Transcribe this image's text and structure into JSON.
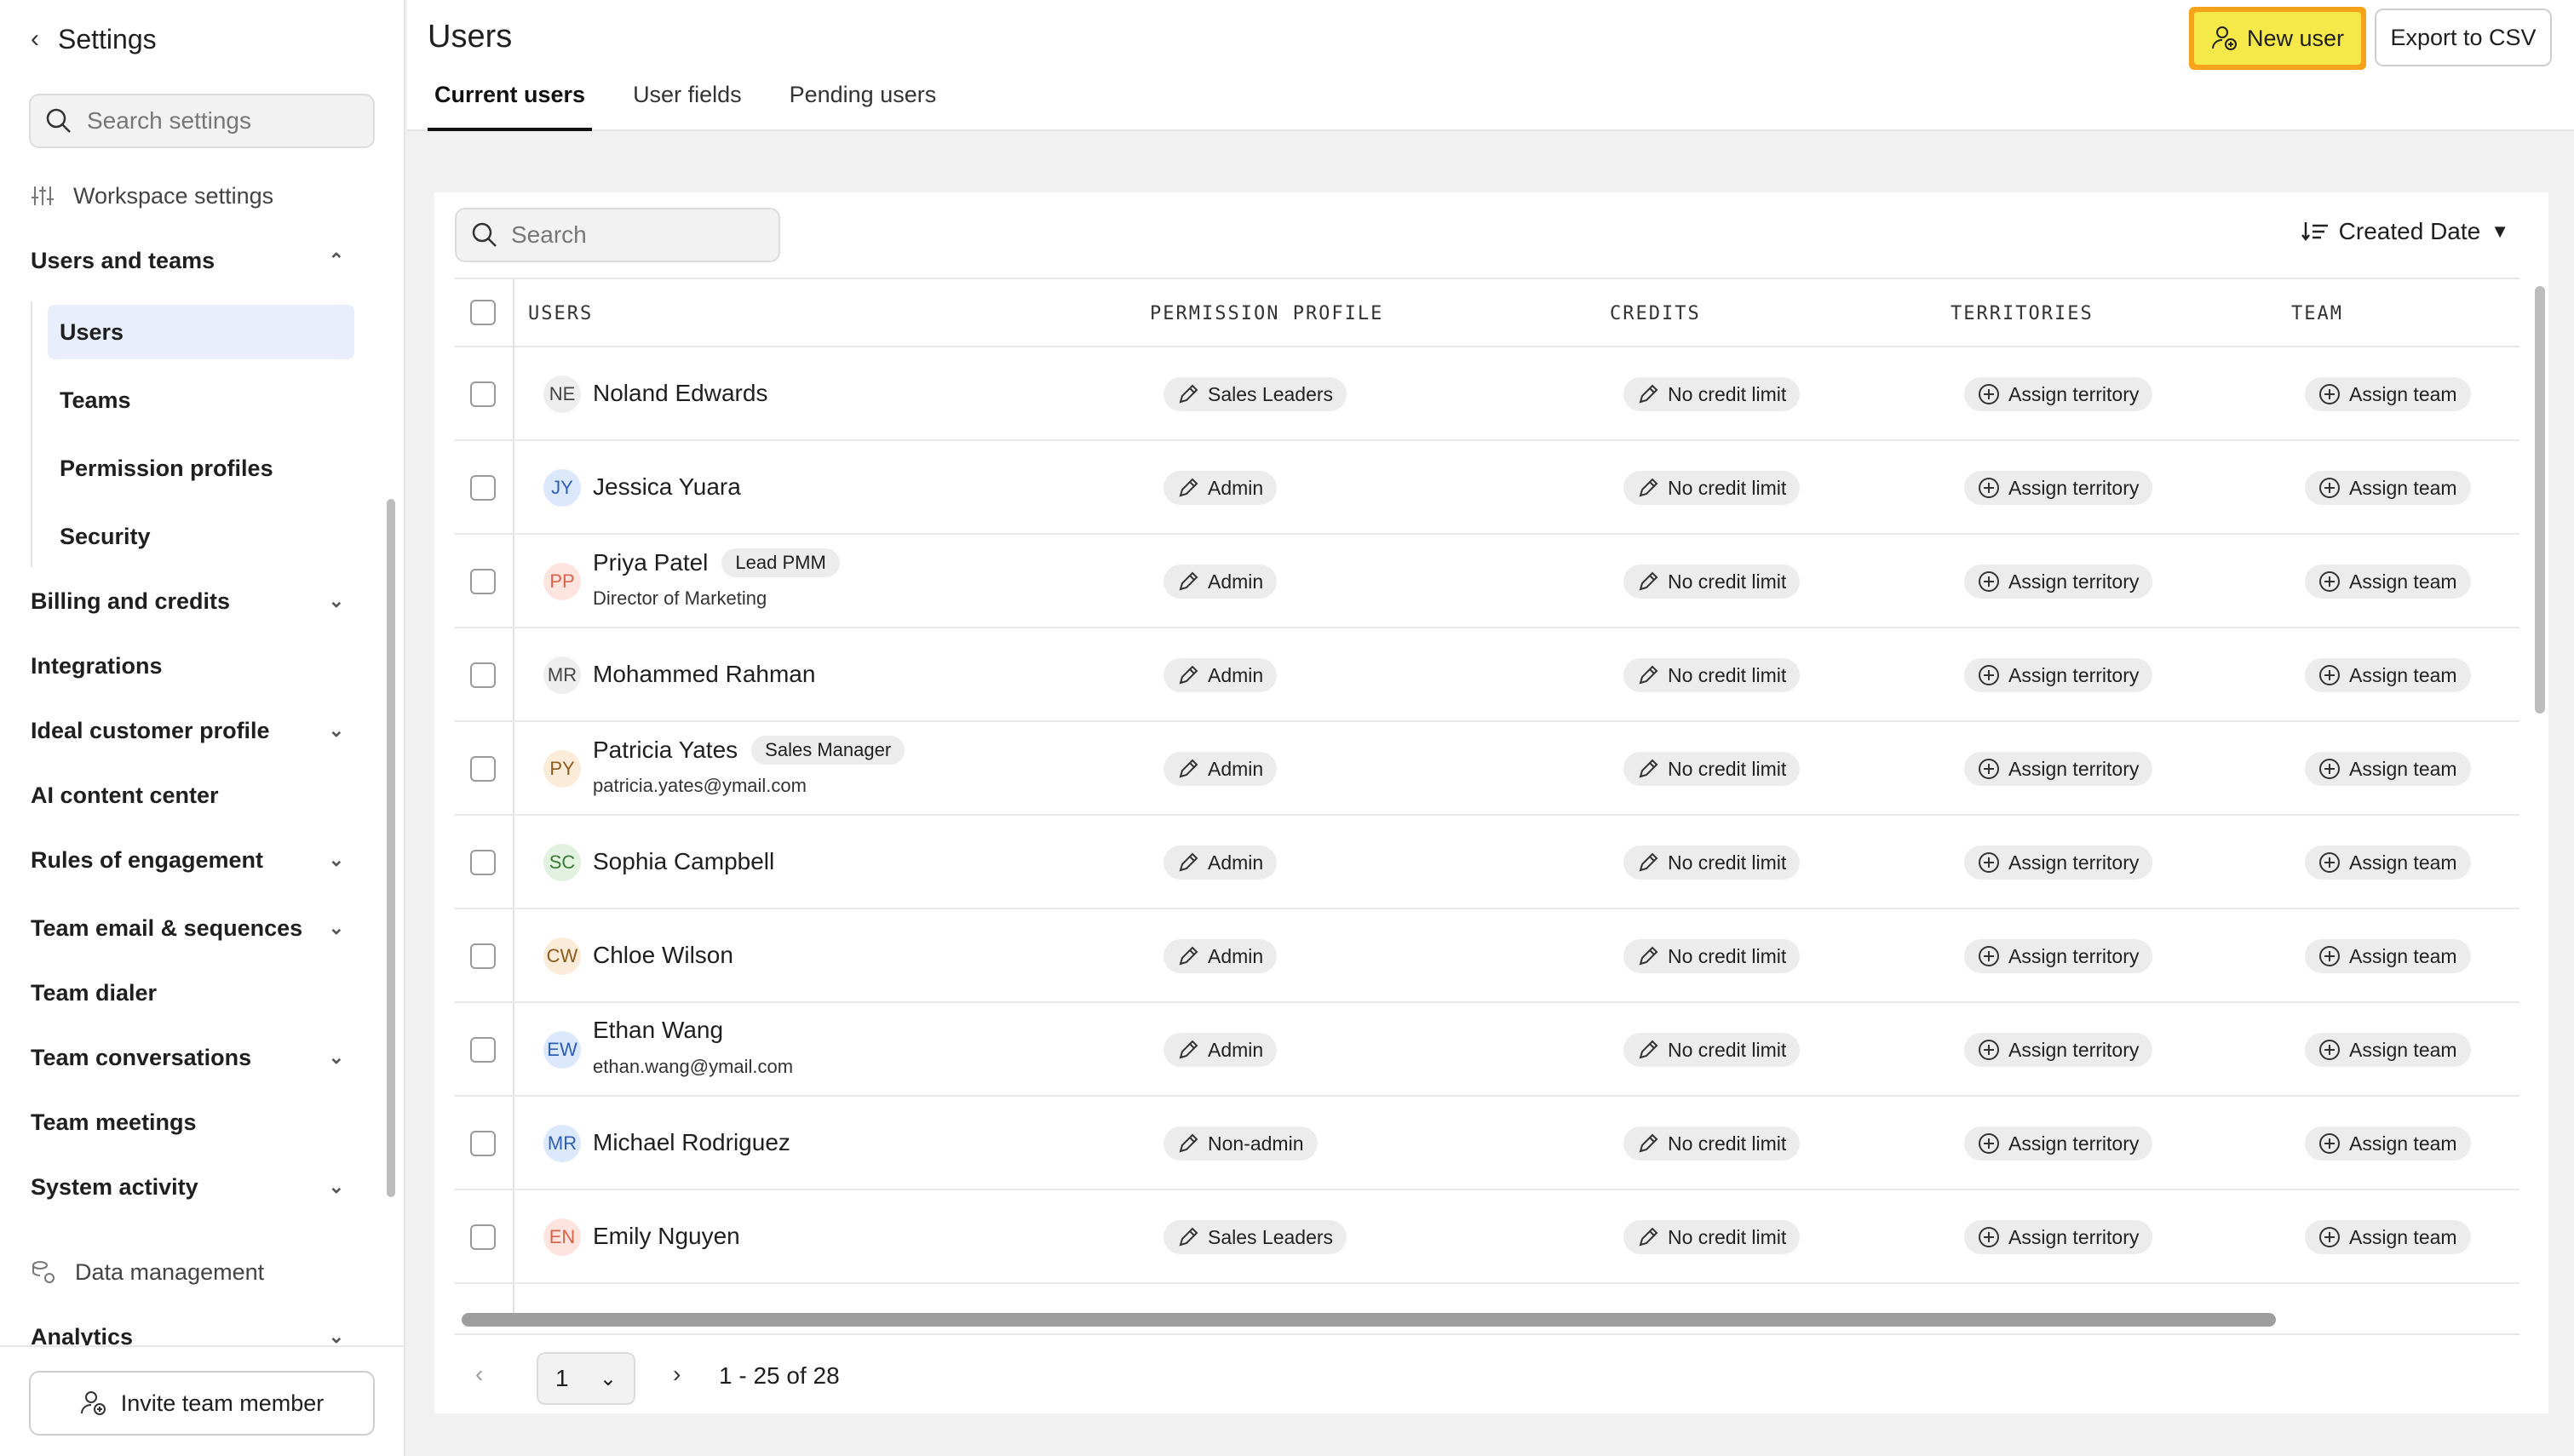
{
  "sidebar": {
    "title": "Settings",
    "search_placeholder": "Search settings",
    "workspace_settings": "Workspace settings",
    "users_and_teams": "Users and teams",
    "sub": [
      "Users",
      "Teams",
      "Permission profiles",
      "Security"
    ],
    "billing": "Billing and credits",
    "integrations": "Integrations",
    "icp": "Ideal customer profile",
    "ai_content": "AI content center",
    "rules": "Rules of engagement",
    "team_email": "Team email & sequences",
    "team_dialer": "Team dialer",
    "team_conversations": "Team conversations",
    "team_meetings": "Team meetings",
    "system_activity": "System activity",
    "data_management": "Data management",
    "analytics": "Analytics",
    "invite": "Invite team member"
  },
  "header": {
    "title": "Users",
    "tabs": [
      "Current users",
      "User fields",
      "Pending users"
    ],
    "new_user": "New user",
    "export": "Export to CSV"
  },
  "table": {
    "search_placeholder": "Search",
    "sort_label": "Created Date",
    "columns": [
      "USERS",
      "PERMISSION PROFILE",
      "CREDITS",
      "TERRITORIES",
      "TEAM"
    ],
    "assign_territory": "Assign territory",
    "assign_team": "Assign team",
    "rows": [
      {
        "initials": "NE",
        "name": "Noland Edwards",
        "tag": "",
        "sub": "",
        "profile": "Sales Leaders",
        "credits": "No credit limit"
      },
      {
        "initials": "JY",
        "name": "Jessica Yuara",
        "tag": "",
        "sub": "",
        "profile": "Admin",
        "credits": "No credit limit"
      },
      {
        "initials": "PP",
        "name": "Priya Patel",
        "tag": "Lead PMM",
        "sub": "Director of Marketing",
        "profile": "Admin",
        "credits": "No credit limit"
      },
      {
        "initials": "MR",
        "name": "Mohammed Rahman",
        "tag": "",
        "sub": "",
        "profile": "Admin",
        "credits": "No credit limit"
      },
      {
        "initials": "PY",
        "name": "Patricia Yates",
        "tag": "Sales Manager",
        "sub": "patricia.yates@ymail.com",
        "profile": "Admin",
        "credits": "No credit limit"
      },
      {
        "initials": "SC",
        "name": "Sophia Campbell",
        "tag": "",
        "sub": "",
        "profile": "Admin",
        "credits": "No credit limit"
      },
      {
        "initials": "CW",
        "name": "Chloe Wilson",
        "tag": "",
        "sub": "",
        "profile": "Admin",
        "credits": "No credit limit"
      },
      {
        "initials": "EW",
        "name": "Ethan Wang",
        "tag": "",
        "sub": "ethan.wang@ymail.com",
        "profile": "Admin",
        "credits": "No credit limit"
      },
      {
        "initials": "MR",
        "name": "Michael Rodriguez",
        "tag": "",
        "sub": "",
        "profile": "Non-admin",
        "credits": "No credit limit"
      },
      {
        "initials": "EN",
        "name": "Emily Nguyen",
        "tag": "",
        "sub": "",
        "profile": "Sales Leaders",
        "credits": "No credit limit"
      }
    ]
  },
  "pager": {
    "page": "1",
    "range": "1 - 25 of 28"
  },
  "colors": {
    "new_user_fill": "#f5e94a",
    "new_user_outline": "#f7a21b",
    "active_nav": "#e8eefb",
    "avatars": [
      "#eeeeee",
      "#dce8fb",
      "#fde4df",
      "#eeeeee",
      "#fbecd9",
      "#e3f1e0",
      "#fbecd9",
      "#dce8fb",
      "#dce8fb",
      "#fde4df"
    ],
    "avatar_text": [
      "#444444",
      "#2f5fb3",
      "#d9634a",
      "#444444",
      "#8a5a1e",
      "#3a7a38",
      "#8a5a1e",
      "#2f5fb3",
      "#2f5fb3",
      "#d9634a"
    ]
  }
}
